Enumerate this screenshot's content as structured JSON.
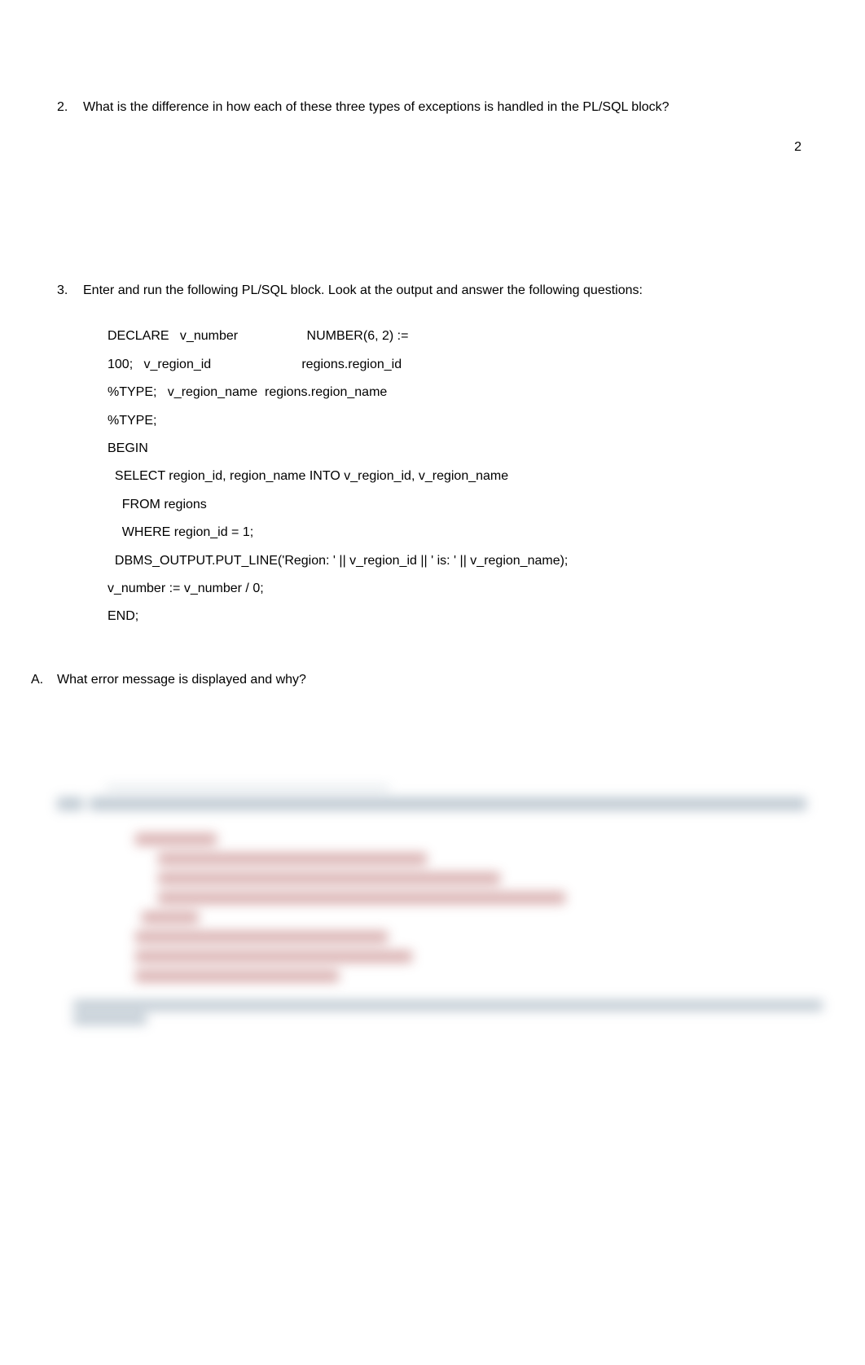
{
  "page_number": "2",
  "question_2": {
    "number": "2.",
    "text": "What is the difference in how each of these three types of exceptions is handled in the PL/SQL block?"
  },
  "question_3": {
    "number": "3.",
    "text": "Enter and run the following PL/SQL block.  Look at the output and answer the following questions:"
  },
  "code": {
    "line1": "DECLARE   v_number                   NUMBER(6, 2) :=",
    "line2": "100;   v_region_id                         regions.region_id",
    "line3": "%TYPE;   v_region_name  regions.region_name",
    "line4": "%TYPE;",
    "line5": "BEGIN",
    "line6": "  SELECT region_id, region_name INTO v_region_id, v_region_name",
    "line7": "    FROM regions",
    "line8": "    WHERE region_id = 1;",
    "line9": "  DBMS_OUTPUT.PUT_LINE('Region: ' || v_region_id || ' is: ' || v_region_name);",
    "line10": "v_number := v_number / 0;",
    "line11": "END;"
  },
  "question_a": {
    "letter": "A.",
    "text": "What error message is displayed and why?"
  }
}
